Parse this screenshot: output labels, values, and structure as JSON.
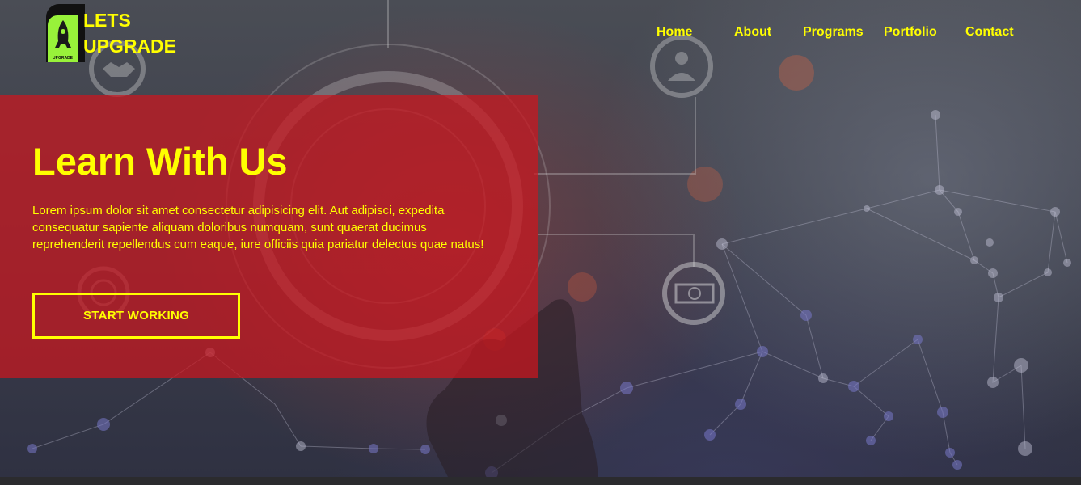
{
  "brand": {
    "line1": "LETS",
    "line2": "UPGRADE",
    "badge_text": "UPGRADE",
    "logo_icon": "rocket-icon",
    "accent_color": "#ffff00",
    "badge_color": "#98f23a"
  },
  "nav": {
    "items": [
      {
        "label": "Home"
      },
      {
        "label": "About"
      },
      {
        "label": "Programs"
      },
      {
        "label": "Portfolio"
      },
      {
        "label": "Contact"
      }
    ]
  },
  "hero": {
    "title": "Learn With Us",
    "text": "Lorem ipsum dolor sit amet consectetur adipisicing elit. Aut adipisci, expedita consequatur sapiente aliquam doloribus numquam, sunt quaerat ducimus reprehenderit repellendus cum eaque, iure officiis quia pariatur delectus quae natus!",
    "button_label": "START WORKING",
    "panel_color": "#cc161e",
    "background_icons": [
      "handshake-icon",
      "businessman-icon",
      "target-icon",
      "dollar-bill-icon",
      "gear-icon",
      "network-graph"
    ]
  }
}
